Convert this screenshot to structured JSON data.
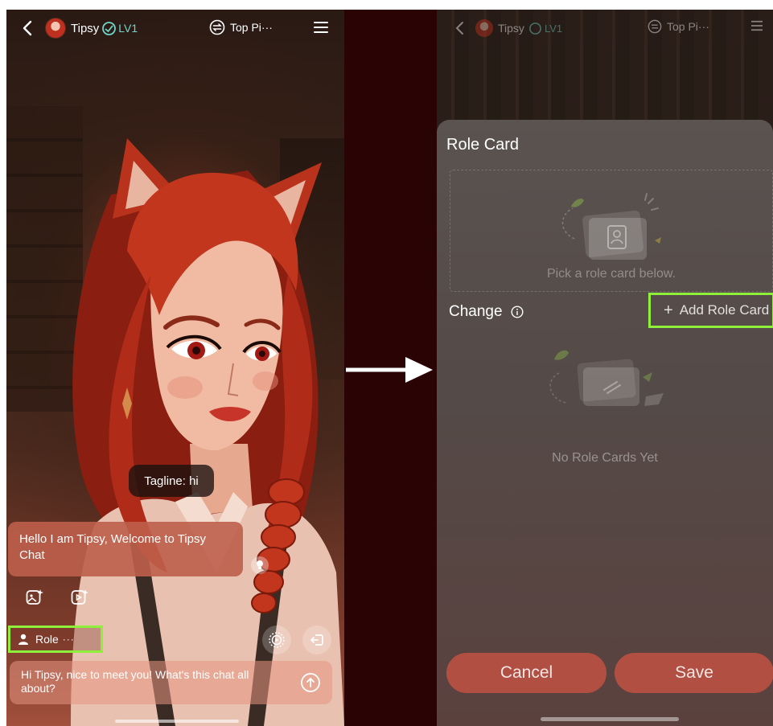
{
  "left": {
    "header": {
      "char_name": "Tipsy",
      "level": "LV1",
      "mode_label": "Top Pi···"
    },
    "tagline": {
      "prefix": "Tagline:",
      "value": "hi"
    },
    "greeting": "Hello I am Tipsy, Welcome to Tipsy Chat",
    "role_button": {
      "label": "Role",
      "dots": "···"
    },
    "chat_input": {
      "value": "Hi Tipsy, nice to meet you! What's this chat all about?"
    }
  },
  "right": {
    "header": {
      "char_name": "Tipsy",
      "level": "LV1",
      "mode_label": "Top Pi···"
    },
    "sheet": {
      "title": "Role Card",
      "drop_hint": "Pick a role card below.",
      "change_label": "Change",
      "add_button": "Add Role Card",
      "empty_text": "No Role Cards Yet",
      "cancel": "Cancel",
      "save": "Save"
    }
  },
  "colors": {
    "highlight": "#8ef03a",
    "button_fill": "#b24f43",
    "level_teal": "#6fd6c8",
    "divider": "#2a0405"
  }
}
